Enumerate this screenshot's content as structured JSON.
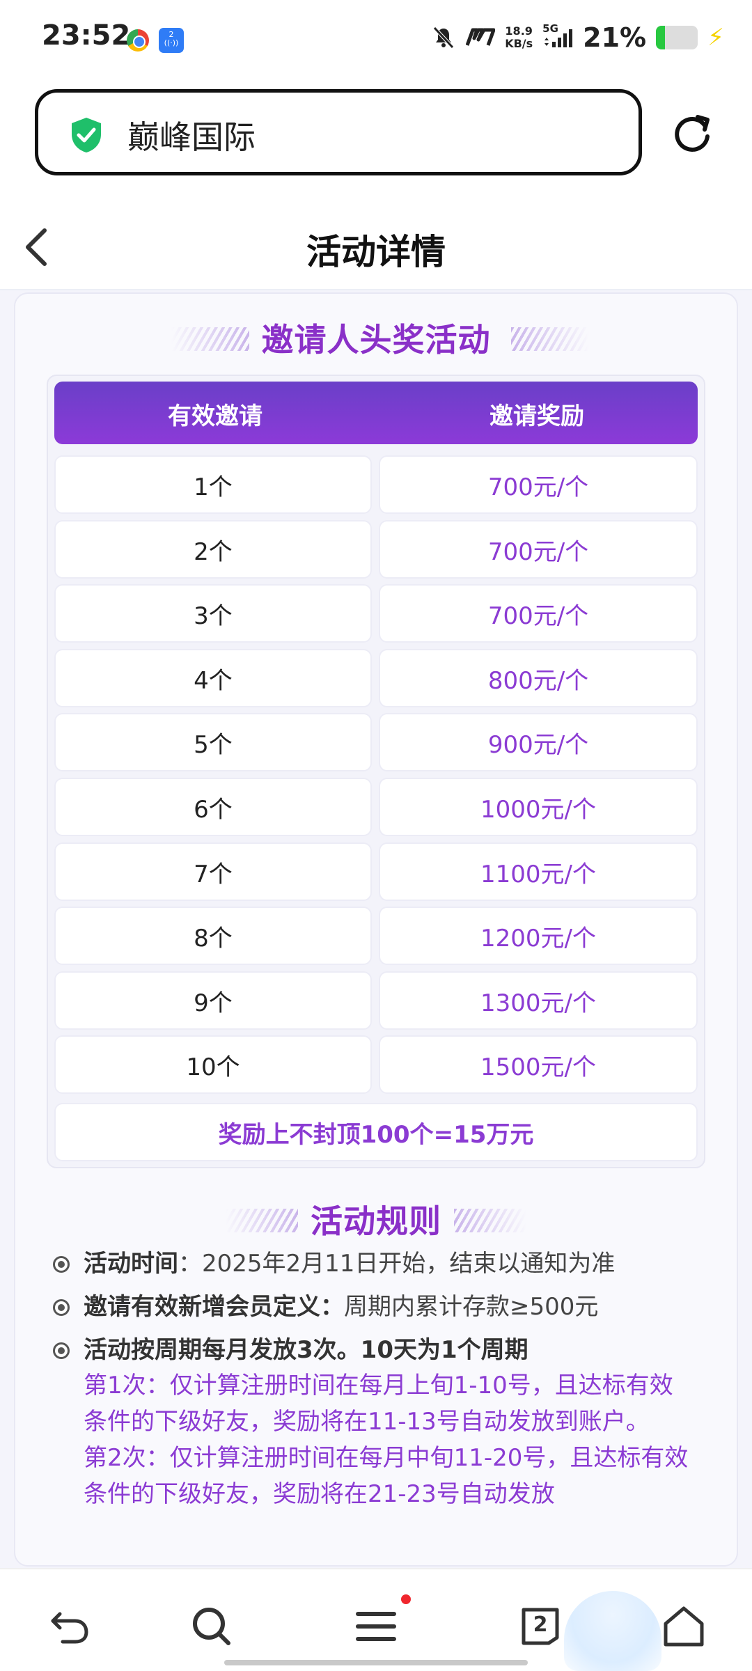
{
  "status_bar": {
    "time": "23:52",
    "net_speed_top": "18.9",
    "net_speed_bottom": "KB/s",
    "network": "5G",
    "battery_percent": "21%",
    "battery_level": 0.21,
    "nfc_badge": "2"
  },
  "browser": {
    "site_name": "巅峰国际"
  },
  "header": {
    "title": "活动详情"
  },
  "invite_section": {
    "title": "邀请人头奖活动",
    "col1_header": "有效邀请",
    "col2_header": "邀请奖励",
    "rows": [
      {
        "count": "1个",
        "reward": "700元/个"
      },
      {
        "count": "2个",
        "reward": "700元/个"
      },
      {
        "count": "3个",
        "reward": "700元/个"
      },
      {
        "count": "4个",
        "reward": "800元/个"
      },
      {
        "count": "5个",
        "reward": "900元/个"
      },
      {
        "count": "6个",
        "reward": "1000元/个"
      },
      {
        "count": "7个",
        "reward": "1100元/个"
      },
      {
        "count": "8个",
        "reward": "1200元/个"
      },
      {
        "count": "9个",
        "reward": "1300元/个"
      },
      {
        "count": "10个",
        "reward": "1500元/个"
      }
    ],
    "footer": "奖励上不封顶100个=15万元"
  },
  "rules_section": {
    "title": "活动规则",
    "rule1_label": "活动时间",
    "rule1_text": "：2025年2月11日开始，结束以通知为准",
    "rule2_label": "邀请有效新增会员定义：",
    "rule2_text": "周期内累计存款≥500元",
    "rule3_label": "活动按周期每月发放3次。10天为1个周期",
    "sub1": "第1次：仅计算注册时间在每月上旬1-10号，且达标有效条件的下级好友，奖励将在11-13号自动发放到账户。",
    "sub2": "第2次：仅计算注册时间在每月中旬11-20号，且达标有效条件的下级好友，奖励将在21-23号自动发放"
  },
  "bottom_nav": {
    "tabs_count": "2"
  },
  "colors": {
    "accent_purple": "#8b3bd3",
    "header_gradient_start": "#6a3fc8",
    "shield_green": "#1fbf6a"
  }
}
